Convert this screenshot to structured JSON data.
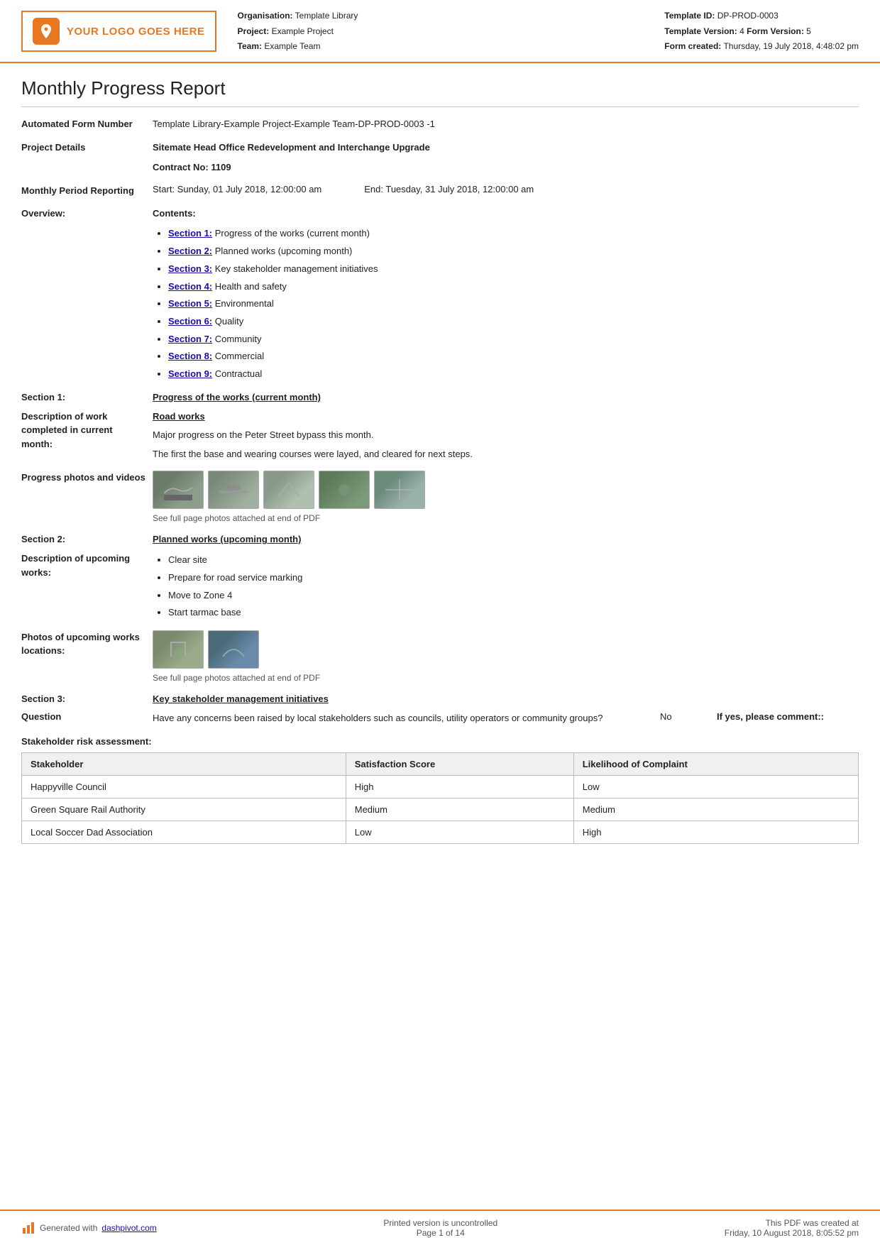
{
  "header": {
    "logo_text": "YOUR LOGO GOES HERE",
    "org_label": "Organisation:",
    "org_value": "Template Library",
    "project_label": "Project:",
    "project_value": "Example Project",
    "team_label": "Team:",
    "team_value": "Example Team",
    "template_id_label": "Template ID:",
    "template_id_value": "DP-PROD-0003",
    "template_version_label": "Template Version:",
    "template_version_value": "4",
    "form_version_label": "Form Version:",
    "form_version_value": "5",
    "form_created_label": "Form created:",
    "form_created_value": "Thursday, 19 July 2018, 4:48:02 pm"
  },
  "report": {
    "title": "Monthly Progress Report",
    "automated_form_label": "Automated Form Number",
    "automated_form_value": "Template Library-Example Project-Example Team-DP-PROD-0003   -1",
    "project_details_label": "Project Details",
    "project_details_value": "Sitemate Head Office Redevelopment and Interchange Upgrade",
    "contract_label": "Contract No:",
    "contract_value": "1109",
    "monthly_period_label": "Monthly Period Reporting",
    "monthly_start": "Start: Sunday, 01 July 2018, 12:00:00 am",
    "monthly_end": "End: Tuesday, 31 July 2018, 12:00:00 am",
    "overview_label": "Overview:",
    "contents_label": "Contents:",
    "contents_items": [
      {
        "link": "Section 1:",
        "text": " Progress of the works (current month)"
      },
      {
        "link": "Section 2:",
        "text": " Planned works (upcoming month)"
      },
      {
        "link": "Section 3:",
        "text": " Key stakeholder management initiatives"
      },
      {
        "link": "Section 4:",
        "text": " Health and safety"
      },
      {
        "link": "Section 5:",
        "text": " Environmental"
      },
      {
        "link": "Section 6:",
        "text": " Quality"
      },
      {
        "link": "Section 7:",
        "text": " Community"
      },
      {
        "link": "Section 8:",
        "text": " Commercial"
      },
      {
        "link": "Section 9:",
        "text": " Contractual"
      }
    ],
    "section1_label": "Section 1:",
    "section1_title": "Progress of the works (current month)",
    "desc_work_label": "Description of work completed in current month:",
    "road_works_heading": "Road works",
    "road_works_text1": "Major progress on the Peter Street bypass this month.",
    "road_works_text2": "The first the base and wearing courses were layed, and cleared for next steps.",
    "progress_photos_label": "Progress photos and videos",
    "photos_caption": "See full page photos attached at end of PDF",
    "section2_label": "Section 2:",
    "section2_title": "Planned works (upcoming month)",
    "upcoming_desc_label": "Description of upcoming works:",
    "upcoming_items": [
      "Clear site",
      "Prepare for road service marking",
      "Move to Zone 4",
      "Start tarmac base"
    ],
    "upcoming_photos_label": "Photos of upcoming works locations:",
    "upcoming_photos_caption": "See full page photos attached at end of PDF",
    "section3_label": "Section 3:",
    "section3_title": "Key stakeholder management initiatives",
    "question_label": "Question",
    "question_text": "Have any concerns been raised by local stakeholders such as councils, utility operators or community groups?",
    "question_no": "No",
    "question_comment": "If yes, please comment::",
    "stakeholder_table_heading": "Stakeholder risk assessment:",
    "table_headers": [
      "Stakeholder",
      "Satisfaction Score",
      "Likelihood of Complaint"
    ],
    "table_rows": [
      [
        "Happyville Council",
        "High",
        "Low"
      ],
      [
        "Green Square Rail Authority",
        "Medium",
        "Medium"
      ],
      [
        "Local Soccer Dad Association",
        "Low",
        "High"
      ]
    ]
  },
  "footer": {
    "generated_text": "Generated with ",
    "dashpivot_link": "dashpivot.com",
    "print_line1": "Printed version is uncontrolled",
    "print_line2": "Page 1 of 14",
    "pdf_created_line1": "This PDF was created at",
    "pdf_created_line2": "Friday, 10 August 2018, 8:05:52 pm"
  }
}
